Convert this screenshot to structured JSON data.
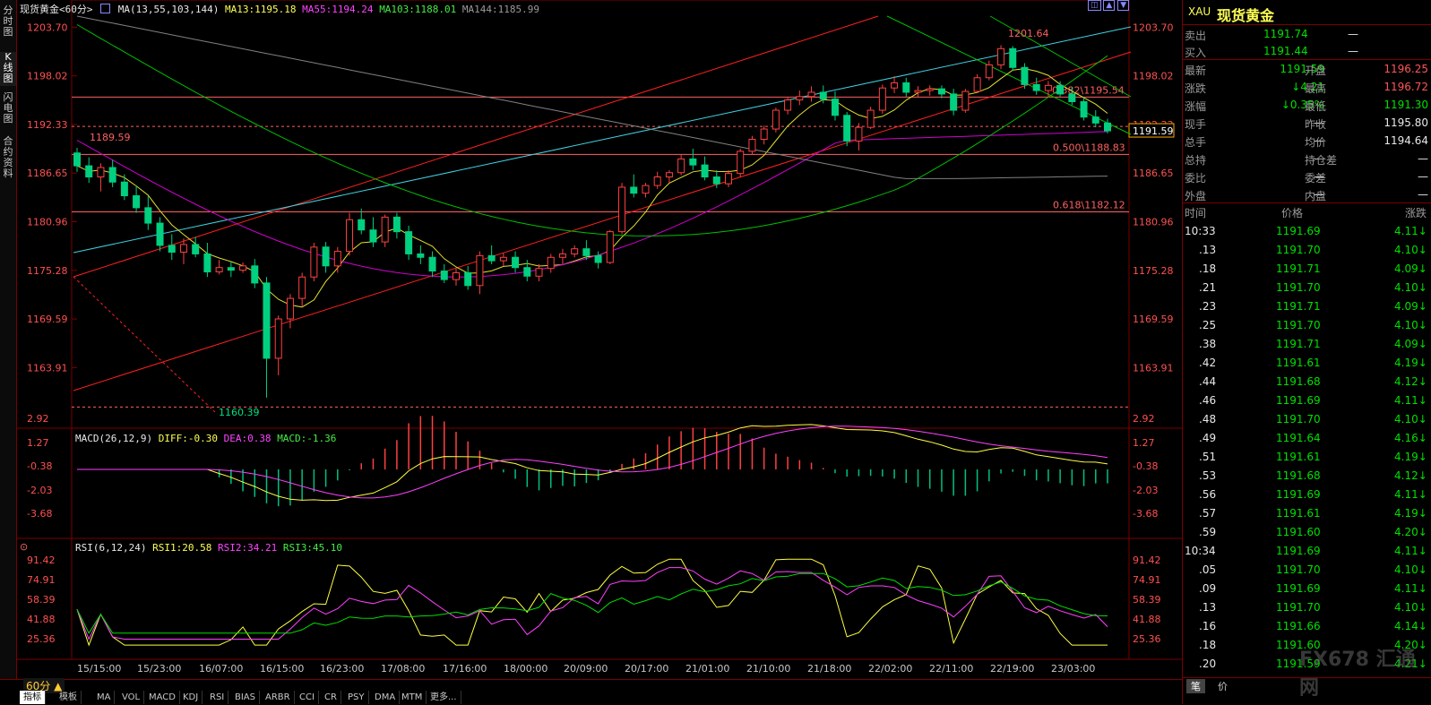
{
  "left_tabs": [
    "分时图",
    "K线图",
    "闪电图",
    "合约资料"
  ],
  "header": {
    "symbol": "现货黄金",
    "period": "<60分>",
    "ma_label": "MA(13,55,103,144)",
    "ma13": "MA13:1195.18",
    "ma55": "MA55:1194.24",
    "ma103": "MA103:1188.01",
    "ma144": "MA144:1185.99"
  },
  "price_axis": [
    "1203.70",
    "1198.02",
    "1192.33",
    "1186.65",
    "1180.96",
    "1175.28",
    "1169.59",
    "1163.91"
  ],
  "current_price_tag": "1191.59",
  "annotations": {
    "high": "1201.64",
    "low": "1160.39",
    "left_mark": "1189.59",
    "fib_382": "0.382\\1195.54",
    "fib_500": "0.500\\1188.83",
    "fib_618": "0.618\\1182.12"
  },
  "macd": {
    "label": "MACD(26,12,9)",
    "diff": "DIFF:-0.30",
    "dea": "DEA:0.38",
    "macd": "MACD:-1.36",
    "axis": [
      "2.92",
      "1.27",
      "-0.38",
      "-2.03",
      "-3.68"
    ]
  },
  "rsi": {
    "label": "RSI(6,12,24)",
    "rsi1": "RSI1:20.58",
    "rsi2": "RSI2:34.21",
    "rsi3": "RSI3:45.10",
    "axis": [
      "91.42",
      "74.91",
      "58.39",
      "41.88",
      "25.36"
    ]
  },
  "time_axis": [
    "15/15:00",
    "15/23:00",
    "16/07:00",
    "16/15:00",
    "16/23:00",
    "17/08:00",
    "17/16:00",
    "18/00:00",
    "20/09:00",
    "20/17:00",
    "21/01:00",
    "21/10:00",
    "21/18:00",
    "22/02:00",
    "22/11:00",
    "22/19:00",
    "23/03:00"
  ],
  "period_button": "60分 ▲",
  "bottom_tabs": [
    "指标",
    "模板",
    "MA",
    "VOL",
    "MACD",
    "KDJ",
    "RSI",
    "BIAS",
    "ARBR",
    "CCI",
    "CR",
    "PSY",
    "DMA",
    "MTM",
    "更多..."
  ],
  "quote": {
    "code": "XAU",
    "name": "现货黄金",
    "sell_label": "卖出",
    "sell": "1191.74",
    "sell_dash": "—",
    "buy_label": "买入",
    "buy": "1191.44",
    "buy_dash": "—",
    "rows": [
      {
        "l1": "最新",
        "v1": "1191.59",
        "l2": "开盘",
        "v2": "1196.25"
      },
      {
        "l1": "涨跌",
        "v1": "↓4.21",
        "l2": "最高",
        "v2": "1196.72"
      },
      {
        "l1": "涨幅",
        "v1": "↓0.35%",
        "l2": "最低",
        "v2": "1191.30"
      },
      {
        "l1": "现手",
        "v1": "—",
        "l2": "昨收",
        "v2": "1195.80"
      },
      {
        "l1": "总手",
        "v1": "—",
        "l2": "均价",
        "v2": "1194.64"
      },
      {
        "l1": "总持",
        "v1": "—",
        "l2": "持仓差",
        "v2": "—"
      },
      {
        "l1": "委比",
        "v1": "—",
        "l2": "委差",
        "v2": "—"
      },
      {
        "l1": "外盘",
        "v1": "—",
        "l2": "内盘",
        "v2": "—"
      }
    ],
    "tick_headers": [
      "时间",
      "价格",
      "涨跌"
    ],
    "ticks": [
      [
        "10:33",
        "1191.69",
        "4.11↓"
      ],
      [
        ".13",
        "1191.70",
        "4.10↓"
      ],
      [
        ".18",
        "1191.71",
        "4.09↓"
      ],
      [
        ".21",
        "1191.70",
        "4.10↓"
      ],
      [
        ".23",
        "1191.71",
        "4.09↓"
      ],
      [
        ".25",
        "1191.70",
        "4.10↓"
      ],
      [
        ".38",
        "1191.71",
        "4.09↓"
      ],
      [
        ".42",
        "1191.61",
        "4.19↓"
      ],
      [
        ".44",
        "1191.68",
        "4.12↓"
      ],
      [
        ".46",
        "1191.69",
        "4.11↓"
      ],
      [
        ".48",
        "1191.70",
        "4.10↓"
      ],
      [
        ".49",
        "1191.64",
        "4.16↓"
      ],
      [
        ".51",
        "1191.61",
        "4.19↓"
      ],
      [
        ".53",
        "1191.68",
        "4.12↓"
      ],
      [
        ".56",
        "1191.69",
        "4.11↓"
      ],
      [
        ".57",
        "1191.61",
        "4.19↓"
      ],
      [
        ".59",
        "1191.60",
        "4.20↓"
      ],
      [
        "10:34",
        "1191.69",
        "4.11↓"
      ],
      [
        ".05",
        "1191.70",
        "4.10↓"
      ],
      [
        ".09",
        "1191.69",
        "4.11↓"
      ],
      [
        ".13",
        "1191.70",
        "4.10↓"
      ],
      [
        ".16",
        "1191.66",
        "4.14↓"
      ],
      [
        ".18",
        "1191.60",
        "4.20↓"
      ],
      [
        ".20",
        "1191.59",
        "4.21↓"
      ]
    ],
    "bottom_tabs": [
      "笔",
      "价"
    ],
    "watermark": "FX678 汇通网"
  },
  "colors": {
    "up": "#ff4040",
    "down": "#00d080",
    "ma13": "#e0e030",
    "ma55": "#d000d0",
    "ma103": "#00c000",
    "ma144": "#808080",
    "grid": "#7a0000"
  },
  "chart_data": {
    "type": "candlestick",
    "ylim": [
      1158.5,
      1205.0
    ],
    "candles": [
      [
        1189,
        1189.6,
        1186.8,
        1187.5
      ],
      [
        1187.5,
        1188.5,
        1185.5,
        1186.2
      ],
      [
        1186.2,
        1187.8,
        1184.5,
        1187.3
      ],
      [
        1187.3,
        1188.2,
        1185,
        1185.6
      ],
      [
        1185.6,
        1186.5,
        1183.5,
        1184
      ],
      [
        1184,
        1185.2,
        1182,
        1182.6
      ],
      [
        1182.6,
        1184,
        1180,
        1180.8
      ],
      [
        1180.8,
        1181.5,
        1177.5,
        1178.2
      ],
      [
        1178.2,
        1179.5,
        1176.5,
        1177.4
      ],
      [
        1177.4,
        1179,
        1176,
        1178.3
      ],
      [
        1178.3,
        1179.2,
        1176.8,
        1177.2
      ],
      [
        1177.2,
        1178.5,
        1174.5,
        1175.1
      ],
      [
        1175.1,
        1176.5,
        1174.8,
        1175.6
      ],
      [
        1175.6,
        1176.3,
        1174.5,
        1175.3
      ],
      [
        1175.3,
        1176.2,
        1175,
        1175.8
      ],
      [
        1175.8,
        1176.6,
        1173.2,
        1173.8
      ],
      [
        1173.8,
        1174.5,
        1160.4,
        1165
      ],
      [
        1165,
        1170,
        1163,
        1169.6
      ],
      [
        1169.6,
        1172.5,
        1168.5,
        1172
      ],
      [
        1172,
        1175,
        1171,
        1174.5
      ],
      [
        1174.5,
        1178.5,
        1174,
        1178
      ],
      [
        1178,
        1178.6,
        1175,
        1175.8
      ],
      [
        1175.8,
        1178,
        1175,
        1177.5
      ],
      [
        1177.5,
        1182,
        1177,
        1181.2
      ],
      [
        1181.2,
        1182.5,
        1179.5,
        1180
      ],
      [
        1180,
        1181.5,
        1178,
        1178.6
      ],
      [
        1178.6,
        1181.8,
        1178,
        1181.5
      ],
      [
        1181.5,
        1182,
        1179,
        1179.8
      ],
      [
        1179.8,
        1180.5,
        1176.5,
        1177.2
      ],
      [
        1177.2,
        1178.2,
        1176,
        1176.8
      ],
      [
        1176.8,
        1177.5,
        1174.5,
        1175.2
      ],
      [
        1175.2,
        1176,
        1173.8,
        1174.2
      ],
      [
        1174.2,
        1175.5,
        1173.5,
        1175
      ],
      [
        1175,
        1175.8,
        1173,
        1173.5
      ],
      [
        1173.5,
        1177.5,
        1172.5,
        1177
      ],
      [
        1177,
        1178.2,
        1176,
        1176.4
      ],
      [
        1176.4,
        1177.3,
        1175.8,
        1176.8
      ],
      [
        1176.8,
        1177.5,
        1175,
        1175.6
      ],
      [
        1175.6,
        1176.5,
        1174,
        1174.6
      ],
      [
        1174.6,
        1176,
        1174,
        1175.5
      ],
      [
        1175.5,
        1177.2,
        1175,
        1176.8
      ],
      [
        1176.8,
        1177.8,
        1176,
        1177.2
      ],
      [
        1177.2,
        1178.2,
        1176.8,
        1177.8
      ],
      [
        1177.8,
        1178.8,
        1176.5,
        1177
      ],
      [
        1177,
        1177.5,
        1175.5,
        1176.2
      ],
      [
        1176.2,
        1180,
        1176,
        1179.8
      ],
      [
        1179.8,
        1185.5,
        1179.5,
        1185
      ],
      [
        1185,
        1186.5,
        1183.8,
        1184.3
      ],
      [
        1184.3,
        1185.5,
        1183.8,
        1185.2
      ],
      [
        1185.2,
        1186.8,
        1184.8,
        1186.2
      ],
      [
        1186.2,
        1187,
        1185.5,
        1186.7
      ],
      [
        1186.7,
        1188.8,
        1186.4,
        1188.3
      ],
      [
        1188.3,
        1189.5,
        1187,
        1187.6
      ],
      [
        1187.6,
        1188.6,
        1185.8,
        1186.2
      ],
      [
        1186.2,
        1187,
        1184.9,
        1185.4
      ],
      [
        1185.4,
        1187,
        1185,
        1186.6
      ],
      [
        1186.6,
        1189.5,
        1186.2,
        1189.2
      ],
      [
        1189.2,
        1191,
        1188.8,
        1190.6
      ],
      [
        1190.6,
        1192.2,
        1190,
        1191.8
      ],
      [
        1191.8,
        1194.3,
        1191.4,
        1194
      ],
      [
        1194,
        1195.5,
        1193.5,
        1195.2
      ],
      [
        1195.2,
        1196.3,
        1194.6,
        1195.6
      ],
      [
        1195.6,
        1196.8,
        1195,
        1196.1
      ],
      [
        1196.1,
        1196.9,
        1194.8,
        1195.3
      ],
      [
        1195.3,
        1196.2,
        1192.8,
        1193.4
      ],
      [
        1193.4,
        1193.8,
        1189.8,
        1190.4
      ],
      [
        1190.4,
        1192.5,
        1189.3,
        1192
      ],
      [
        1192,
        1194.4,
        1191.8,
        1194
      ],
      [
        1194,
        1197,
        1193.6,
        1196.6
      ],
      [
        1196.6,
        1198,
        1196,
        1197.2
      ],
      [
        1197.2,
        1197.8,
        1195.6,
        1196.1
      ],
      [
        1196.1,
        1196.8,
        1195.5,
        1196.3
      ],
      [
        1196.3,
        1196.9,
        1195.7,
        1196.5
      ],
      [
        1196.5,
        1196.9,
        1195.4,
        1195.9
      ],
      [
        1195.9,
        1196.5,
        1193.4,
        1194
      ],
      [
        1194,
        1196.5,
        1193.7,
        1196.2
      ],
      [
        1196.2,
        1198.2,
        1196,
        1197.8
      ],
      [
        1197.8,
        1199.8,
        1197.5,
        1199.3
      ],
      [
        1199.3,
        1201.6,
        1198.8,
        1201.2
      ],
      [
        1201.2,
        1201.5,
        1198.6,
        1199
      ],
      [
        1199,
        1199.5,
        1196.5,
        1197
      ],
      [
        1197,
        1197.8,
        1195.8,
        1196.3
      ],
      [
        1196.3,
        1197.4,
        1195.6,
        1196.9
      ],
      [
        1196.9,
        1197.4,
        1195.6,
        1195.9
      ],
      [
        1195.9,
        1196.7,
        1194.6,
        1195
      ],
      [
        1195,
        1195.5,
        1192.8,
        1193.2
      ],
      [
        1193.2,
        1194,
        1192,
        1192.5
      ],
      [
        1192.5,
        1193,
        1191.3,
        1191.59
      ]
    ],
    "horizontal_lines": [
      1195.54,
      1192.1,
      1188.83,
      1182.12,
      1159.3
    ]
  }
}
